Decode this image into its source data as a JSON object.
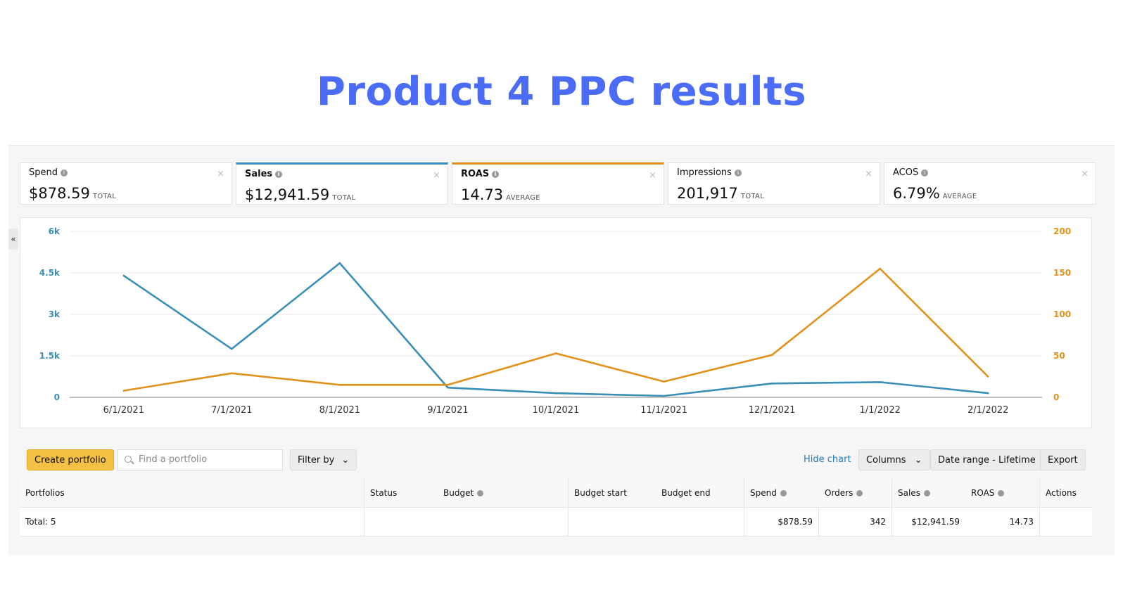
{
  "headline": "Product 4 PPC results",
  "collapse_icon": "«",
  "metrics": [
    {
      "name": "Spend",
      "value": "$878.59",
      "sub": "TOTAL"
    },
    {
      "name": "Sales",
      "value": "$12,941.59",
      "sub": "TOTAL"
    },
    {
      "name": "ROAS",
      "value": "14.73",
      "sub": "AVERAGE"
    },
    {
      "name": "Impressions",
      "value": "201,917",
      "sub": "TOTAL"
    },
    {
      "name": "ACOS",
      "value": "6.79%",
      "sub": "AVERAGE"
    }
  ],
  "close_glyph": "×",
  "colors": {
    "sales": "#3a8fb7",
    "roas": "#e0921d",
    "primary_button": "#f5c145",
    "link": "#1a7bbf",
    "headline": "#4a6cf7"
  },
  "chart_data": {
    "type": "line",
    "x": [
      "6/1/2021",
      "7/1/2021",
      "8/1/2021",
      "9/1/2021",
      "10/1/2021",
      "11/1/2021",
      "12/1/2021",
      "1/1/2022",
      "2/1/2022"
    ],
    "series": [
      {
        "name": "Sales",
        "axis": "left",
        "values": [
          4400,
          1750,
          4850,
          350,
          150,
          50,
          500,
          550,
          150
        ]
      },
      {
        "name": "ROAS",
        "axis": "right",
        "values": [
          8,
          29,
          15,
          15,
          53,
          19,
          51,
          155,
          25
        ]
      }
    ],
    "y_left": {
      "ylim": [
        0,
        6000
      ],
      "ticks": [
        "0",
        "1.5k",
        "3k",
        "4.5k",
        "6k"
      ],
      "tick_values": [
        0,
        1500,
        3000,
        4500,
        6000
      ]
    },
    "y_right": {
      "ylim": [
        0,
        200
      ],
      "ticks": [
        "0",
        "50",
        "100",
        "150",
        "200"
      ],
      "tick_values": [
        0,
        50,
        100,
        150,
        200
      ]
    },
    "grid": true,
    "legend": "none"
  },
  "toolbar": {
    "create": "Create portfolio",
    "search_placeholder": "Find a portfolio",
    "filter": "Filter by",
    "hide_chart": "Hide chart",
    "columns": "Columns",
    "date_range": "Date range - Lifetime",
    "export": "Export",
    "chevron": "⌄"
  },
  "table": {
    "headers": [
      "Portfolios",
      "Status",
      "Budget",
      "Budget start",
      "Budget end",
      "Spend",
      "Orders",
      "Sales",
      "ROAS",
      "Actions"
    ],
    "total_label": "Total: 5",
    "total_spend": "$878.59",
    "total_orders": "342",
    "total_sales": "$12,941.59",
    "total_roas": "14.73"
  }
}
